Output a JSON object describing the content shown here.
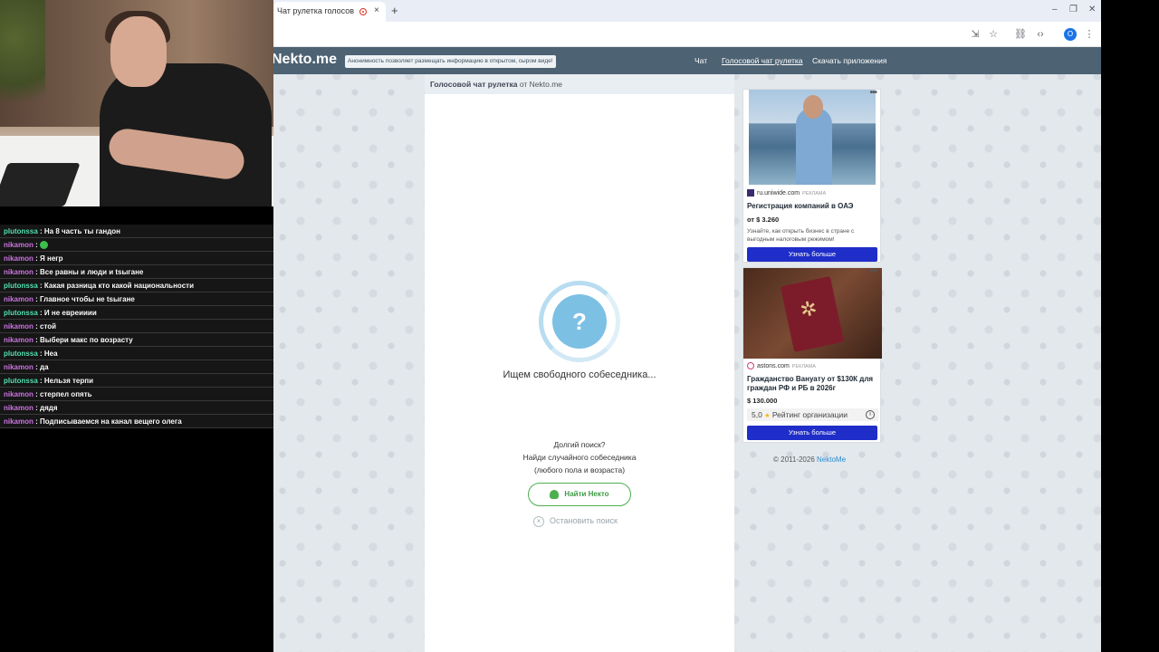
{
  "stream_chat": [
    {
      "user": "plutonssa",
      "text": "На 8 часть ты гандон",
      "emoji": false
    },
    {
      "user": "nikamon",
      "text": "",
      "emoji": true
    },
    {
      "user": "nikamon",
      "text": "Я негр",
      "emoji": false
    },
    {
      "user": "nikamon",
      "text": "Все равны и люди и tsыгане",
      "emoji": false
    },
    {
      "user": "plutonssa",
      "text": "Какая разница кто какой национальности",
      "emoji": false
    },
    {
      "user": "nikamon",
      "text": "Главное чтобы не tsыгане",
      "emoji": false
    },
    {
      "user": "plutonssa",
      "text": "И не евреииии",
      "emoji": false
    },
    {
      "user": "nikamon",
      "text": "стой",
      "emoji": false
    },
    {
      "user": "nikamon",
      "text": "Выбери макс по возрасту",
      "emoji": false
    },
    {
      "user": "plutonssa",
      "text": "Неа",
      "emoji": false
    },
    {
      "user": "nikamon",
      "text": "да",
      "emoji": false
    },
    {
      "user": "plutonssa",
      "text": "Нельзя терпи",
      "emoji": false
    },
    {
      "user": "nikamon",
      "text": "стерпел опять",
      "emoji": false
    },
    {
      "user": "nikamon",
      "text": "дядя",
      "emoji": false
    },
    {
      "user": "nikamon",
      "text": "Подписываемся на канал вещего олега",
      "emoji": false
    }
  ],
  "browser": {
    "tab_title": "Чат рулетка голосов",
    "tab_close": "×",
    "new_tab": "+",
    "minimize": "–",
    "maximize": "❐",
    "close": "✕",
    "profile_letter": "O"
  },
  "site": {
    "logo": "Nekto.me",
    "banner": "Анонимность позволяет размещать информацию в открытом, сыром виде!",
    "nav": {
      "chat": "Чат",
      "voice": "Голосовой чат рулетка",
      "apps": "Скачать приложения"
    },
    "panel": {
      "title_bold": "Голосовой чат рулетка",
      "title_rest": " от Nekto.me",
      "question_mark": "?",
      "searching": "Ищем свободного собеседника...",
      "long_search": "Долгий поиск?",
      "long_search_line2": "Найди случайного собеседника",
      "long_search_line3": "(любого пола и возраста)",
      "find_button": "Найти Некто",
      "stop_icon": "×",
      "stop_search": "Остановить поиск"
    },
    "ads": [
      {
        "dots": "•••",
        "source": "ru.uniwide.com",
        "tag": "РЕКЛАМА",
        "title": "Регистрация компаний в ОАЭ",
        "price": "от $ 3.260",
        "desc": "Узнайте, как открыть бизнес в стране с выгодным налоговым режимом!",
        "cta": "Узнать больше"
      },
      {
        "dots": "•••",
        "source": "astons.com",
        "tag": "РЕКЛАМА",
        "title": "Гражданство Вануату от $130К для граждан РФ и РБ в 2026г",
        "price": "$ 130.000",
        "rating_value": "5,0",
        "rating_star": "★",
        "rating_label": "Рейтинг организации",
        "info_icon": "i",
        "cta": "Узнать больше"
      }
    ],
    "footer": {
      "copyright": "© 2011-2026 ",
      "link": "NektoMe"
    }
  }
}
